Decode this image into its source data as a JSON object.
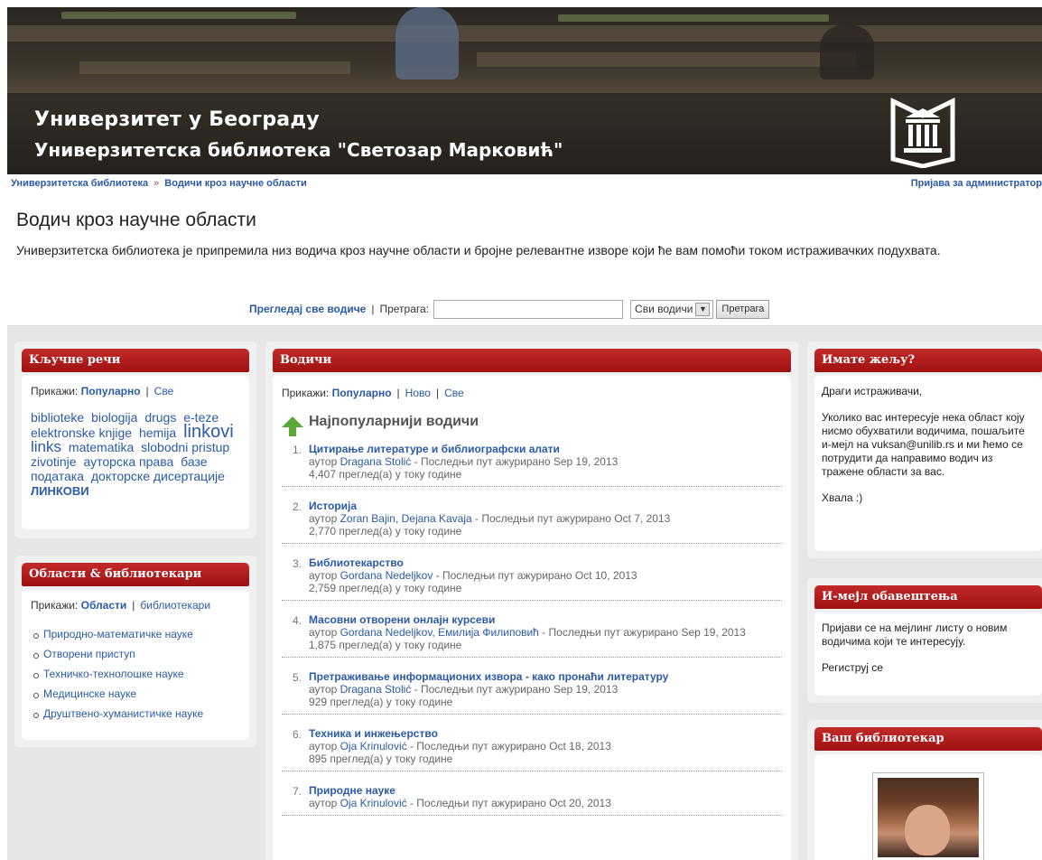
{
  "banner": {
    "line1": "Универзитет у Београду",
    "line2": "Универзитетска библиотека \"Светозар Марковић\""
  },
  "breadcrumb": {
    "home": "Универзитетска библиотека",
    "separator": "»",
    "current": "Водичи кроз научне области"
  },
  "admin_link": "Пријава за администратор",
  "page_title": "Водич кроз научне области",
  "intro": "Универзитетска библиотека је припремила низ водича кроз научне области и бројне релевантне изворе који ће вам помоћи током истраживачких подухвата.",
  "search": {
    "browse_all": "Прегледај све водиче",
    "separator": "|",
    "label": "Претрага:",
    "value": "",
    "scope": "Сви водичи",
    "button": "Претрага"
  },
  "keywords": {
    "heading": "Кључне речи",
    "show_label": "Прикажи:",
    "popular": "Популарно",
    "all": "Све",
    "tags": [
      {
        "text": "biblioteke",
        "size": "n"
      },
      {
        "text": "biologija",
        "size": "n"
      },
      {
        "text": "drugs",
        "size": "n"
      },
      {
        "text": "e-teze",
        "size": "n"
      },
      {
        "text": "elektronske knjige",
        "size": "n"
      },
      {
        "text": "hemija",
        "size": "n"
      },
      {
        "text": "linkovi",
        "size": "big"
      },
      {
        "text": "links",
        "size": "mid"
      },
      {
        "text": "matematika",
        "size": "n"
      },
      {
        "text": "slobodni pristup",
        "size": "n"
      },
      {
        "text": "zivotinje",
        "size": "n"
      },
      {
        "text": "ауторска права",
        "size": "n"
      },
      {
        "text": "базе података",
        "size": "n"
      },
      {
        "text": "докторске дисертације",
        "size": "n"
      },
      {
        "text": "ЛИНКОВИ",
        "size": "bold"
      }
    ]
  },
  "areas": {
    "heading": "Области & библиотекари",
    "show_label": "Прикажи:",
    "areas_tab": "Области",
    "librarians_tab": "библиотекари",
    "items": [
      "Природно-математичке науке",
      "Отворени приступ",
      "Техничко-технолошке науке",
      "Медицинске науке",
      "Друштвено-хуманистичке науке"
    ]
  },
  "guides": {
    "heading": "Водичи",
    "show_label": "Прикажи:",
    "popular": "Популарно",
    "new": "Ново",
    "all": "Све",
    "section_title": "Најпопуларнији водичи",
    "items": [
      {
        "n": "1.",
        "title": "Цитирање литературе и библиографски алати",
        "by": "аутор",
        "author": "Dragana Stolić",
        "updated": " - Последњи пут ажурирано Sep 19, 2013",
        "views": "4,407 преглед(а) у току године"
      },
      {
        "n": "2.",
        "title": "Историја",
        "by": "аутор",
        "author": "Zoran Bajin, Dejana Kavaja",
        "updated": " - Последњи пут ажурирано Oct 7, 2013",
        "views": "2,770 преглед(а) у току године"
      },
      {
        "n": "3.",
        "title": "Библиотекарство",
        "by": "аутор",
        "author": "Gordana Nedeljkov",
        "updated": " - Последњи пут ажурирано Oct 10, 2013",
        "views": "2,759 преглед(а) у току године"
      },
      {
        "n": "4.",
        "title": "Масовни отворени онлајн курсеви",
        "by": "аутор",
        "author": "Gordana Nedeljkov, Емилија Филиповић",
        "updated": " - Последњи пут ажурирано Sep 19, 2013",
        "views": "1,875 преглед(а) у току године"
      },
      {
        "n": "5.",
        "title": "Претраживање информационих извора - како пронаћи литературу",
        "by": "аутор",
        "author": "Dragana Stolić",
        "updated": " - Последњи пут ажурирано Sep 19, 2013",
        "views": "929 преглед(а) у току године"
      },
      {
        "n": "6.",
        "title": "Техника и инжењерство",
        "by": "аутор",
        "author": "Oja Krinulović",
        "updated": " - Последњи пут ажурирано Oct 18, 2013",
        "views": "895 преглед(а) у току године"
      },
      {
        "n": "7.",
        "title": "Природне науке",
        "by": "аутор",
        "author": "Oja Krinulović",
        "updated": " - Последњи пут ажурирано Oct 20, 2013",
        "views": ""
      }
    ]
  },
  "wish": {
    "heading": "Имате жељу?",
    "greeting": "Драги истраживачи,",
    "body": "Уколико вас интересује нека област коју нисмо обухватили водичима, пошаљите и-мејл на vuksan@unilib.rs и ми ћемо се потрудити да направимо водич из тражене области за вас.",
    "thanks": "Хвала :)"
  },
  "email": {
    "heading": "И-мејл обавештења",
    "body": "Пријави се на мејлинг листу о новим водичима који те интересују.",
    "register": "Региструј се"
  },
  "librarian": {
    "heading": "Ваш библиотекар"
  },
  "colors": {
    "header_red": "#b01c1c",
    "link_blue": "#2b5aa8",
    "zone_gray": "#e6e6e6"
  }
}
